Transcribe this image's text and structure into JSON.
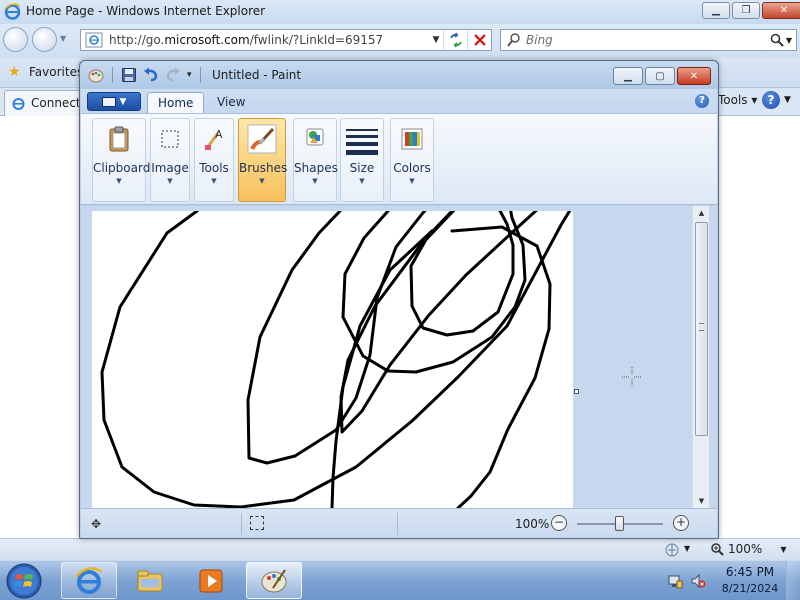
{
  "ie": {
    "window_title": "Home Page - Windows Internet Explorer",
    "address_prefix": "http://go.",
    "address_domain": "microsoft.com",
    "address_suffix": "/fwlink/?LinkId=69157",
    "search_placeholder": "Bing",
    "favorites_label": "Favorites",
    "tab_label": "Connecti",
    "tools_label": "Tools",
    "status_zoom": "100%"
  },
  "paint": {
    "window_title": "Untitled - Paint",
    "tabs": [
      {
        "label": "Home",
        "active": true
      },
      {
        "label": "View",
        "active": false
      }
    ],
    "groups": [
      {
        "label": "Clipboard",
        "icon": "clipboard-icon",
        "active": false
      },
      {
        "label": "Image",
        "icon": "image-select-icon",
        "active": false
      },
      {
        "label": "Tools",
        "icon": "tools-icon",
        "active": false
      },
      {
        "label": "Brushes",
        "icon": "brush-icon",
        "active": true
      },
      {
        "label": "Shapes",
        "icon": "shapes-icon",
        "active": false
      },
      {
        "label": "Size",
        "icon": "size-icon",
        "active": false
      },
      {
        "label": "Colors",
        "icon": "colors-icon",
        "active": false
      }
    ],
    "zoom": "100%"
  },
  "taskbar": {
    "time": "6:45 PM",
    "date": "8/21/2024",
    "items": [
      "internet-explorer-icon",
      "windows-explorer-icon",
      "media-player-icon",
      "paint-icon"
    ]
  },
  "colors": {
    "accent": "#1b4ea5",
    "active_group": "#f7c15d",
    "canvas": "#ffffff",
    "workspace": "#c7d8ee"
  }
}
